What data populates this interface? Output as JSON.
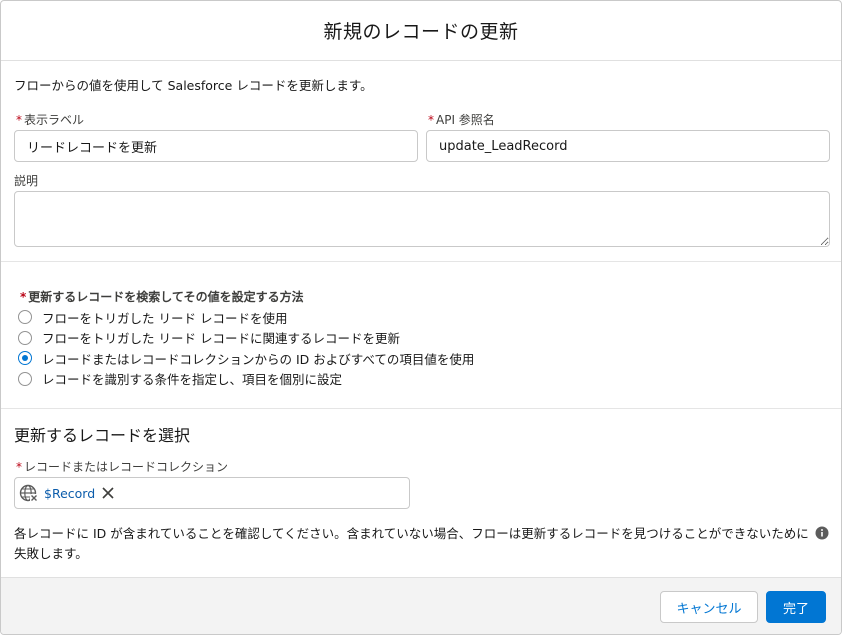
{
  "modal": {
    "title": "新規のレコードの更新",
    "intro": "フローからの値を使用して Salesforce レコードを更新します。"
  },
  "fields": {
    "label_label": "表示ラベル",
    "label_value": "リードレコードを更新",
    "api_label": "API 参照名",
    "api_value": "update_LeadRecord",
    "description_label": "説明",
    "required_marker": "*"
  },
  "method": {
    "label": "更新するレコードを検索してその値を設定する方法",
    "options": [
      {
        "label": "フローをトリガした リード レコードを使用",
        "checked": false
      },
      {
        "label": "フローをトリガした リード レコードに関連するレコードを更新",
        "checked": false
      },
      {
        "label": "レコードまたはレコードコレクションからの ID およびすべての項目値を使用",
        "checked": true
      },
      {
        "label": "レコードを識別する条件を指定し、項目を個別に設定",
        "checked": false
      }
    ]
  },
  "selection": {
    "title": "更新するレコードを選択",
    "lookup_label": "レコードまたはレコードコレクション",
    "pill_label": "$Record",
    "pill_icon": "globe-variable-icon",
    "note": "各レコードに ID が含まれていることを確認してください。含まれていない場合、フローは更新するレコードを見つけることができないために失敗します。"
  },
  "footer": {
    "cancel_label": "キャンセル",
    "done_label": "完了"
  },
  "colors": {
    "brand": "#0176d3",
    "required": "#ba0517",
    "pill_text": "#0b5cab"
  }
}
